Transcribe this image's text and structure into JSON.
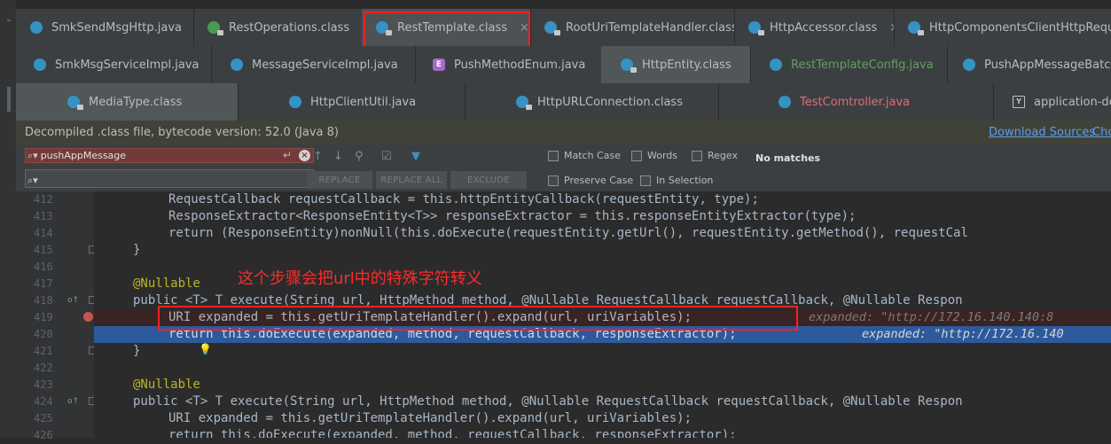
{
  "tabs_row1": [
    {
      "label": "SmkSendMsgHttp.java",
      "icon": "class-icon"
    },
    {
      "label": "RestOperations.class",
      "icon": "interface-icon"
    },
    {
      "label": "RestTemplate.class",
      "icon": "class-icon",
      "active": true
    },
    {
      "label": "RootUriTemplateHandler.class",
      "icon": "class-icon"
    },
    {
      "label": "HttpAccessor.class",
      "icon": "class-icon"
    },
    {
      "label": "HttpComponentsClientHttpRequest",
      "icon": "class-icon"
    }
  ],
  "tabs_row2": [
    {
      "label": "SmkMsgServiceImpl.java",
      "icon": "class-icon"
    },
    {
      "label": "MessageServiceImpl.java",
      "icon": "class-icon"
    },
    {
      "label": "PushMethodEnum.java",
      "icon": "enum-icon"
    },
    {
      "label": "HttpEntity.class",
      "icon": "class-icon"
    },
    {
      "label": "RestTemplateConfig.java",
      "icon": "class-icon"
    },
    {
      "label": "PushAppMessageBatchH",
      "icon": "class-icon"
    }
  ],
  "tabs_row3": [
    {
      "label": "MediaType.class",
      "icon": "class-icon"
    },
    {
      "label": "HttpClientUtil.java",
      "icon": "class-icon"
    },
    {
      "label": "HttpURLConnection.class",
      "icon": "class-icon"
    },
    {
      "label": "TestComtroller.java",
      "icon": "class-icon"
    },
    {
      "label": "application-de",
      "icon": "yml-icon"
    }
  ],
  "close_glyph": "×",
  "infobar": {
    "text": "Decompiled .class file, bytecode version: 52.0 (Java 8)",
    "download_link": "Download Sources",
    "choose_link": "Cho"
  },
  "find": {
    "search_value": "pushAppMessage",
    "buttons": [
      "REPLACE",
      "REPLACE ALL",
      "EXCLUDE"
    ],
    "options": [
      "Match Case",
      "Words",
      "Regex",
      "Preserve Case",
      "In Selection"
    ],
    "status": "No matches"
  },
  "note": "这个步骤会把url中的特殊字符转义",
  "code_lines": [
    {
      "num": "412",
      "text": "RequestCallback requestCallback = this.httpEntityCallback(requestEntity, type);"
    },
    {
      "num": "413",
      "text": "ResponseExtractor<ResponseEntity<T>> responseExtractor = this.responseEntityExtractor(type);"
    },
    {
      "num": "414",
      "text": "return (ResponseEntity)nonNull(this.doExecute(requestEntity.getUrl(), requestEntity.getMethod(), requestCal"
    },
    {
      "num": "415",
      "text": "}"
    },
    {
      "num": "416",
      "text": ""
    },
    {
      "num": "417",
      "text": "@Nullable"
    },
    {
      "num": "418",
      "text": "public <T> T execute(String url, HttpMethod method, @Nullable RequestCallback requestCallback, @Nullable Respon"
    },
    {
      "num": "419",
      "text": "URI expanded = this.getUriTemplateHandler().expand(url, uriVariables);",
      "inline": "expanded: \"http://172.16.140.140:8"
    },
    {
      "num": "420",
      "text": "return this.doExecute(expanded, method, requestCallback, responseExtractor);",
      "inline": "expanded: \"http://172.16.140"
    },
    {
      "num": "421",
      "text": "}"
    },
    {
      "num": "422",
      "text": ""
    },
    {
      "num": "423",
      "text": "@Nullable"
    },
    {
      "num": "424",
      "text": "public <T> T execute(String url, HttpMethod method, @Nullable RequestCallback requestCallback, @Nullable Respon"
    },
    {
      "num": "425",
      "text": "URI expanded = this.getUriTemplateHandler().expand(url, uriVariables);"
    },
    {
      "num": "426",
      "text": "return this.doExecute(expanded, method, requestCallback, responseExtractor);"
    }
  ],
  "colors": {
    "keyword": "#cc7832",
    "annotation": "#bbb529",
    "string": "#6a8759",
    "highlight": "#2d5a9c",
    "annotation_red": "#ff2020"
  }
}
